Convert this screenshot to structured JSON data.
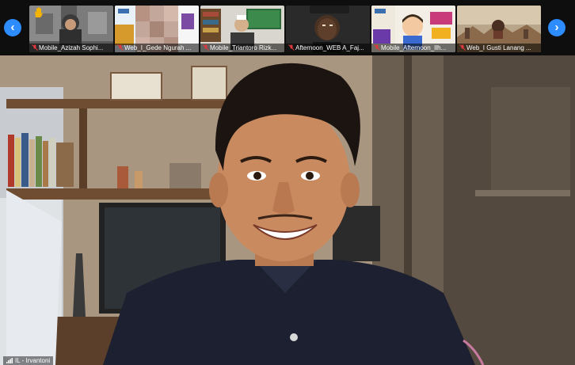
{
  "thumbnails": [
    {
      "label": "Mobile_Azizah Sophi...",
      "hand_raised": true
    },
    {
      "label": "Web_I_Gede Ngurah ...",
      "hand_raised": false
    },
    {
      "label": "Mobile_Triantoro Rizk...",
      "hand_raised": false
    },
    {
      "label": "Afternoon_WEB A_Faj...",
      "hand_raised": false
    },
    {
      "label": "Mobile_Afternoon_Ilh...",
      "hand_raised": false
    },
    {
      "label": "Web_I Gusti Lanang ...",
      "hand_raised": false
    }
  ],
  "main_speaker": {
    "name": "IL - Irvantoni"
  },
  "nav": {
    "prev_icon": "‹",
    "next_icon": "›"
  },
  "colors": {
    "accent": "#2d8cff",
    "muted": "#e0393e"
  }
}
